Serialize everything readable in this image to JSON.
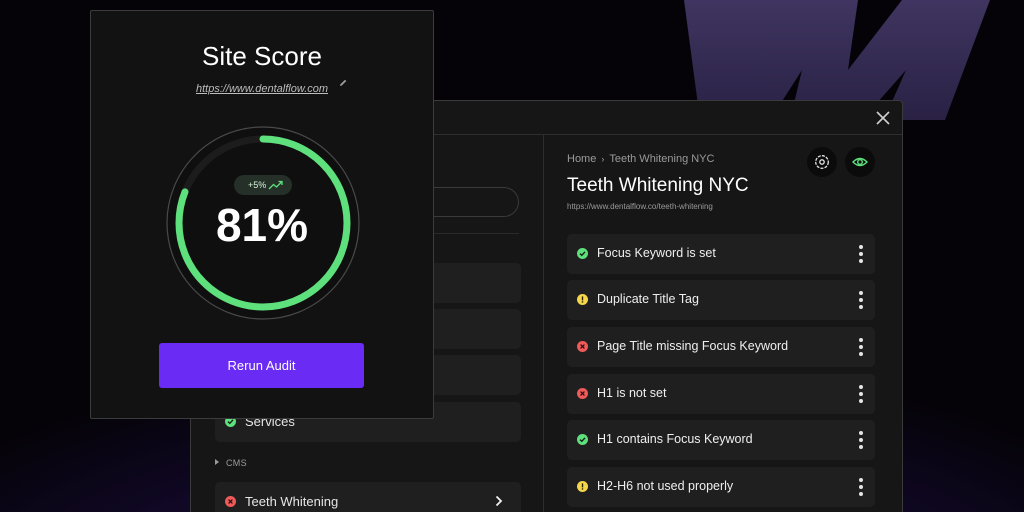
{
  "colors": {
    "accent": "#6a2bf5",
    "success": "#5ee07d",
    "warning": "#f5d54a",
    "error": "#ef5a5a",
    "brand_mark": "#3d3358"
  },
  "score_card": {
    "title": "Site Score",
    "url": "https://www.dentalflow.com",
    "score": 81,
    "score_label": "81%",
    "trend_label": "+5%",
    "rerun_label": "Rerun Audit"
  },
  "sidebar": {
    "items": [
      {
        "label": "Services",
        "status": "success"
      }
    ],
    "section_label": "CMS",
    "cms_items": [
      {
        "label": "Teeth Whitening",
        "status": "error"
      }
    ]
  },
  "detail": {
    "breadcrumb": [
      "Home",
      "Teeth Whitening NYC"
    ],
    "title": "Teeth Whitening NYC",
    "url": "https://www.dentalflow.co/teeth-whitening",
    "checks": [
      {
        "label": "Focus Keyword is set",
        "status": "success"
      },
      {
        "label": "Duplicate Title Tag",
        "status": "warning"
      },
      {
        "label": "Page Title missing Focus Keyword",
        "status": "error"
      },
      {
        "label": "H1 is not set",
        "status": "error"
      },
      {
        "label": "H1 contains Focus Keyword",
        "status": "success"
      },
      {
        "label": "H2-H6 not used properly",
        "status": "warning"
      }
    ]
  }
}
